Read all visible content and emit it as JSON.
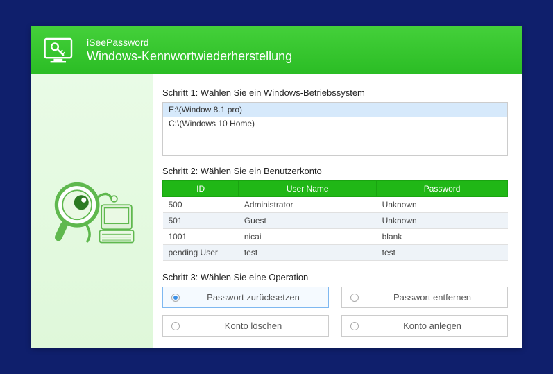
{
  "header": {
    "brand": "iSeePassword",
    "title": "Windows-Kennwortwiederherstellung"
  },
  "step1": {
    "label": "Schritt 1: Wählen Sie ein Windows-Betriebssystem",
    "items": [
      {
        "text": "E:\\(Window 8.1 pro)",
        "selected": true
      },
      {
        "text": "C:\\(Windows 10 Home)",
        "selected": false
      }
    ]
  },
  "step2": {
    "label": "Schritt 2: Wählen Sie ein Benutzerkonto",
    "columns": {
      "id": "ID",
      "user": "User Name",
      "pwd": "Password"
    },
    "rows": [
      {
        "id": "500",
        "user": "Administrator",
        "pwd": "Unknown"
      },
      {
        "id": "501",
        "user": "Guest",
        "pwd": "Unknown"
      },
      {
        "id": "1001",
        "user": "nicai",
        "pwd": "blank"
      },
      {
        "id": "pending User",
        "user": "test",
        "pwd": "test"
      }
    ]
  },
  "step3": {
    "label": "Schritt 3: Wählen Sie eine Operation",
    "ops": [
      {
        "label": "Passwort zurücksetzen",
        "selected": true
      },
      {
        "label": "Passwort entfernen",
        "selected": false
      },
      {
        "label": "Konto löschen",
        "selected": false
      },
      {
        "label": "Konto anlegen",
        "selected": false
      }
    ]
  }
}
